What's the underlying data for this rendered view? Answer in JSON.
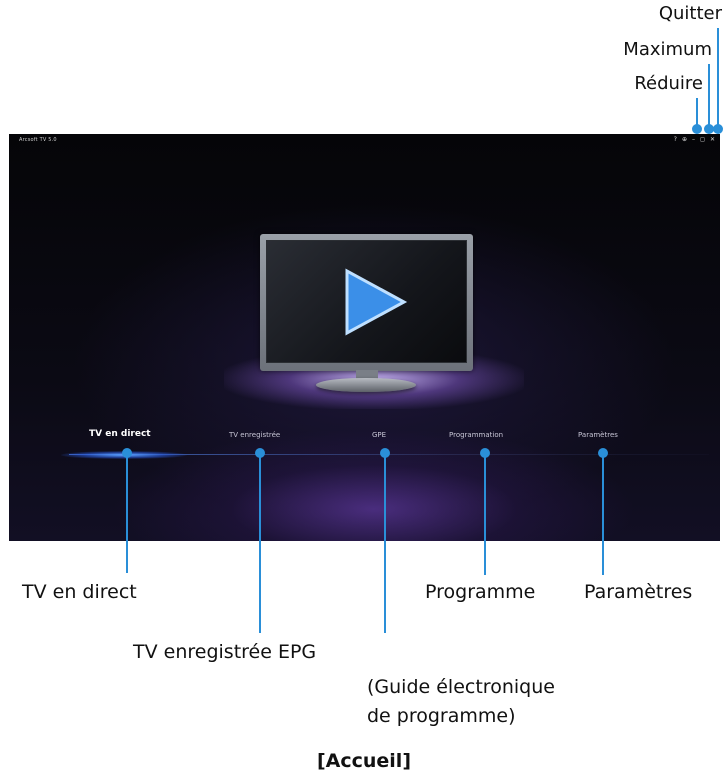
{
  "window_controls": {
    "quit_label": "Quitter",
    "maximize_label": "Maximum",
    "minimize_label": "Réduire"
  },
  "app": {
    "title": "Arcsoft TV 5.0",
    "window_buttons": [
      "?",
      "⊕",
      "–",
      "◻",
      "✕"
    ]
  },
  "menu": {
    "items": [
      {
        "label": "TV en direct",
        "active": true
      },
      {
        "label": "TV enregistrée",
        "active": false
      },
      {
        "label": "GPE",
        "active": false
      },
      {
        "label": "Programmation",
        "active": false
      },
      {
        "label": "Paramètres",
        "active": false
      }
    ]
  },
  "callouts": {
    "live_tv": "TV en direct",
    "recorded_epg": "TV enregistrée EPG",
    "guide_line1": "(Guide électronique",
    "guide_line2": "de programme)",
    "program": "Programme",
    "settings": "Paramètres"
  },
  "caption": "[Accueil]",
  "colors": {
    "accent": "#2a8fd8",
    "screen_bg": "#0b0a14",
    "play_icon": "#3b8fe8"
  }
}
